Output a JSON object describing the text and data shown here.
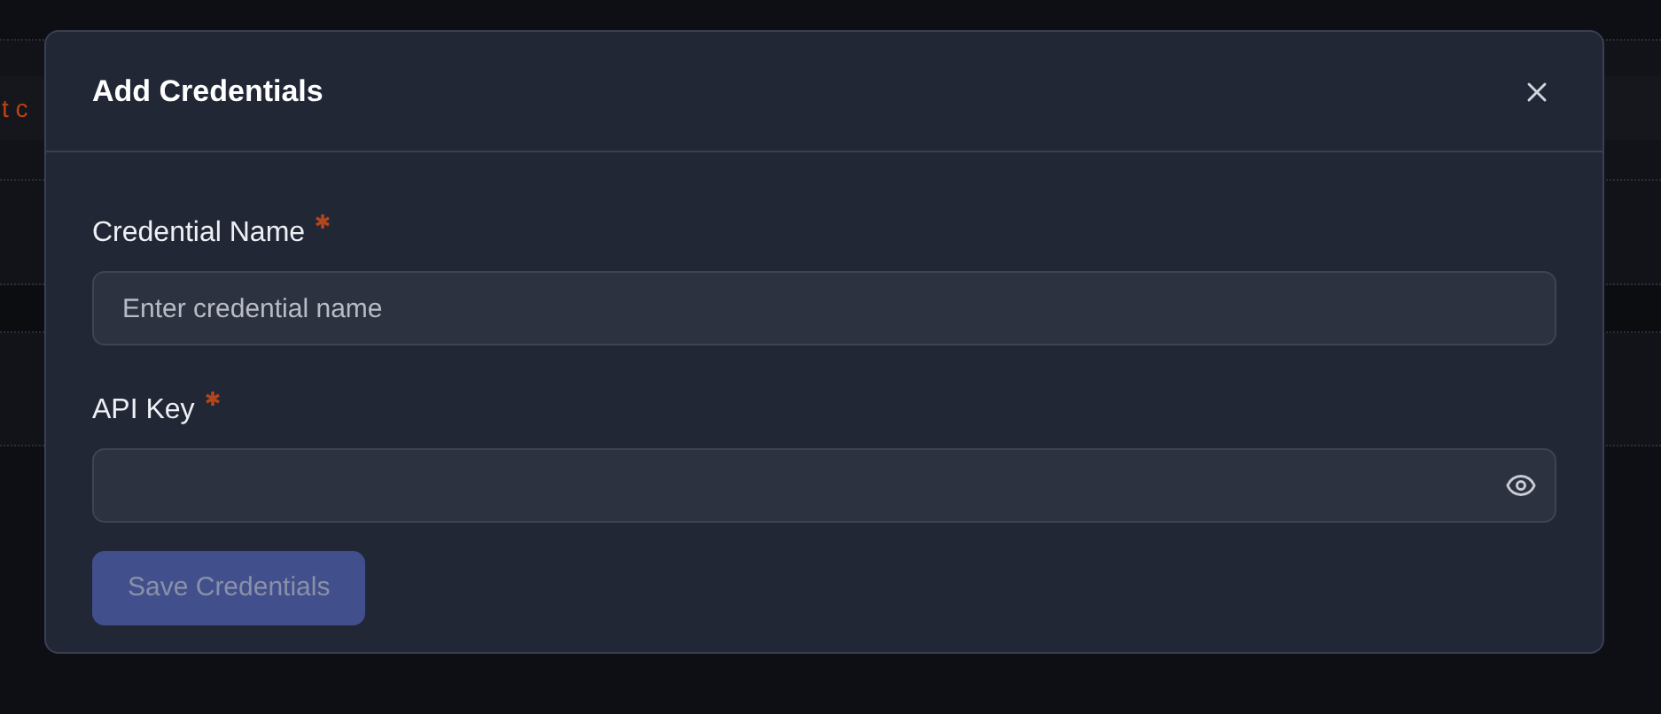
{
  "background": {
    "notice": "t c"
  },
  "dialog": {
    "title": "Add Credentials",
    "fields": [
      {
        "label": "Credential Name",
        "required": true,
        "placeholder": "Enter credential name",
        "kind": "text"
      },
      {
        "label": "API Key",
        "required": true,
        "kind": "password"
      }
    ],
    "save_button": {
      "label": "Save Credentials",
      "disabled": true
    }
  }
}
